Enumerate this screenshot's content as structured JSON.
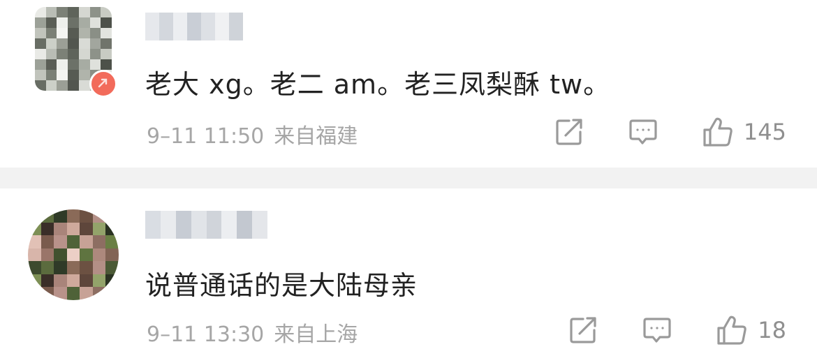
{
  "comments": [
    {
      "username": "",
      "text": "老大 xg。老二 am。老三凤梨酥 tw。",
      "time": "9–11 11:50",
      "location": "来自福建",
      "likes": "145",
      "has_badge": true
    },
    {
      "username": "",
      "text": "说普通话的是大陆母亲",
      "time": "9–11 13:30",
      "location": "来自上海",
      "likes": "18",
      "has_badge": false
    }
  ],
  "icons": {
    "share": "share-icon",
    "reply": "comment-icon",
    "like": "thumbs-up-icon",
    "badge": "verified-badge-icon"
  },
  "colors": {
    "text": "#222222",
    "meta": "#a6a6a6",
    "icon": "#9a9a9a",
    "badge": "#f26b5b",
    "separator": "#f2f2f2"
  }
}
